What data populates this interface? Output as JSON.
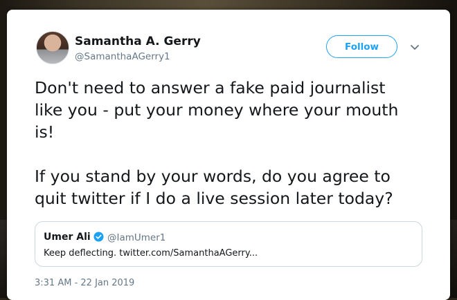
{
  "author": {
    "name": "Samantha A. Gerry",
    "handle": "@SamanthaAGerry1"
  },
  "follow_label": "Follow",
  "tweet": {
    "text": "Don't need to answer a fake paid journalist\nlike you - put your money where your mouth\nis!\n\nIf you stand by your words, do you agree to\nquit twitter if I do a live session later today?"
  },
  "quoted": {
    "name": "Umer Ali",
    "handle": "@IamUmer1",
    "text": "Keep deflecting. twitter.com/SamanthaAGerry...",
    "verified": true
  },
  "timestamp": "3:31 AM - 22 Jan 2019",
  "icons": {
    "caret": "chevron-down-icon",
    "verified": "verified-badge-icon"
  },
  "colors": {
    "accent": "#1da1f2",
    "text": "#14171a",
    "secondary": "#657786"
  }
}
